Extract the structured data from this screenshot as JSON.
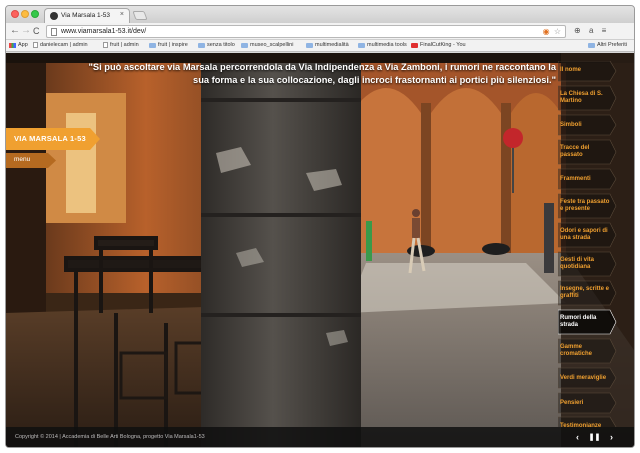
{
  "browser": {
    "tab_title": "Via Marsala 1-53",
    "tab_close": "×",
    "url": "www.viamarsala1-53.it/dev/",
    "omni_icons": [
      "◉",
      "☆"
    ],
    "extensions": [
      "⊕",
      "a",
      "≡"
    ],
    "nav": {
      "back": "←",
      "forward": "→",
      "reload": "C"
    }
  },
  "bookmarks": {
    "items": [
      {
        "label": "App",
        "icon": "apps-icon"
      },
      {
        "label": "danielecam | admin",
        "icon": "page-icon"
      },
      {
        "label": "fruit | admin",
        "icon": "page-icon"
      },
      {
        "label": "fruit | inspire",
        "icon": "folder-icon"
      },
      {
        "label": "senza titolo",
        "icon": "folder-icon"
      },
      {
        "label": "museo_scalpellini",
        "icon": "folder-icon"
      },
      {
        "label": "multimedialità",
        "icon": "folder-icon"
      },
      {
        "label": "multimedia tools",
        "icon": "folder-icon"
      },
      {
        "label": "FinalCutKing - You",
        "icon": "youtube-icon"
      }
    ],
    "other": "Altri Preferiti"
  },
  "page": {
    "quote": "\"Si può ascoltare via Marsala percorrendola da Via Indipendenza a Via Zamboni, i rumori ne raccontano la sua forma e la sua collocazione, dagli incroci frastornanti ai portici più silenziosi.\"",
    "site_label": "VIA MARSALA 1-53",
    "menu_label": "menu",
    "accent_color": "#f0a030",
    "sidemenu": [
      {
        "label": "Il nome"
      },
      {
        "label": "La Chiesa di S. Martino"
      },
      {
        "label": "Simboli"
      },
      {
        "label": "Tracce del passato"
      },
      {
        "label": "Frammenti"
      },
      {
        "label": "Feste tra passato e presente"
      },
      {
        "label": "Odori e sapori di una strada"
      },
      {
        "label": "Gesti di vita quotidiana"
      },
      {
        "label": "Insegne, scritte e graffiti"
      },
      {
        "label": "Rumori della strada",
        "active": true
      },
      {
        "label": "Gamme cromatiche"
      },
      {
        "label": "Verdi meraviglie"
      },
      {
        "label": "Pensieri"
      },
      {
        "label": "Testimonianze"
      }
    ],
    "footer": "Copyright © 2014 | Accademia di Belle Arti Bologna, progetto Via Marsala1-53",
    "controls": {
      "prev": "‹",
      "pause": "❚❚",
      "next": "›"
    }
  }
}
